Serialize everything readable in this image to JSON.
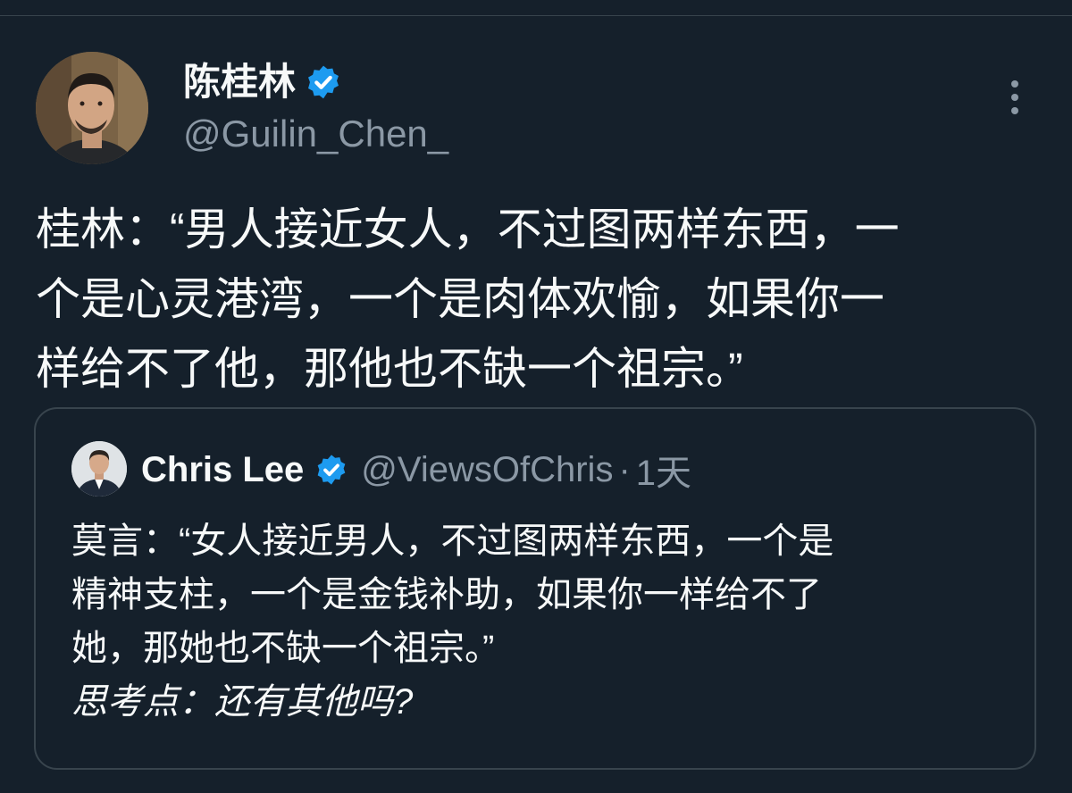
{
  "tweet": {
    "author": {
      "display_name": "陈桂林",
      "handle": "@Guilin_Chen_",
      "verified": true,
      "avatar_icon": "user-avatar-photo"
    },
    "text_lines": [
      "桂林：“男人接近女人，不过图两样东西，一",
      "个是心灵港湾，一个是肉体欢愉，如果你一",
      "样给不了他，那他也不缺一个祖宗。”"
    ],
    "more_icon": "more-vertical-icon"
  },
  "quoted_tweet": {
    "author": {
      "display_name": "Chris Lee",
      "handle": "@ViewsOfChris",
      "verified": true,
      "avatar_icon": "user-avatar-photo"
    },
    "separator": "·",
    "time": "1天",
    "text_lines": [
      "莫言：“女人接近男人，不过图两样东西，一个是",
      "精神支柱，一个是金钱补助，如果你一样给不了",
      "她，那她也不缺一个祖宗。”"
    ],
    "note": "思考点：还有其他吗?"
  },
  "colors": {
    "background": "#15202b",
    "text_primary": "#f7f9f9",
    "text_secondary": "#8b98a5",
    "border": "#38444d",
    "verified_badge": "#1d9bf0"
  }
}
